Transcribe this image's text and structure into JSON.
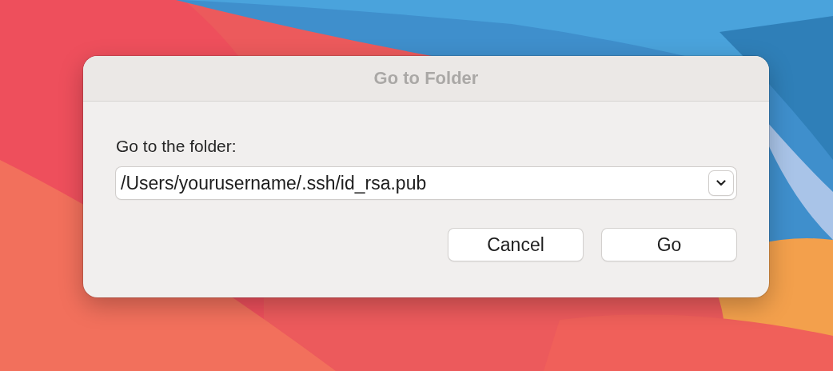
{
  "dialog": {
    "title": "Go to Folder"
  },
  "prompt": "Go to the folder:",
  "path_field": {
    "value": "/Users/yourusername/.ssh/id_rsa.pub"
  },
  "buttons": [
    "Cancel",
    "Go"
  ]
}
